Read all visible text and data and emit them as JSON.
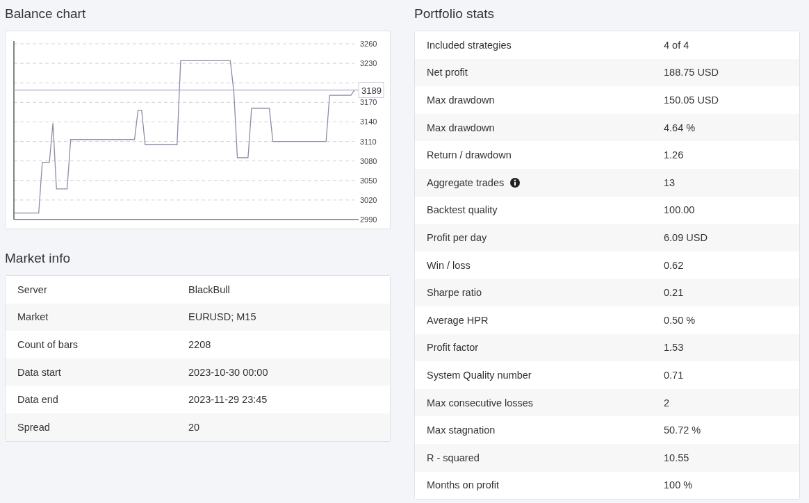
{
  "balance_chart": {
    "title": "Balance chart",
    "chart_data": {
      "type": "line",
      "grid": true,
      "series": [
        {
          "color": "#8c8ca8",
          "values": [
            3000,
            3000,
            3000,
            3000,
            3000,
            3000,
            3000,
            3000,
            3078,
            3078,
            3078,
            3138,
            3037,
            3037,
            3037,
            3037,
            3113,
            3113,
            3113,
            3113,
            3113,
            3113,
            3113,
            3113,
            3113,
            3113,
            3113,
            3113,
            3113,
            3113,
            3113,
            3113,
            3113,
            3113,
            3113,
            3158,
            3158,
            3105,
            3105,
            3105,
            3105,
            3105,
            3105,
            3105,
            3105,
            3105,
            3105,
            3234,
            3234,
            3234,
            3234,
            3234,
            3234,
            3234,
            3234,
            3234,
            3234,
            3234,
            3234,
            3234,
            3234,
            3234,
            3186,
            3085,
            3085,
            3085,
            3085,
            3161,
            3161,
            3161,
            3161,
            3161,
            3161,
            3110,
            3110,
            3110,
            3110,
            3110,
            3110,
            3110,
            3110,
            3110,
            3110,
            3110,
            3110,
            3110,
            3110,
            3110,
            3110,
            3181,
            3181,
            3181,
            3181,
            3181,
            3181,
            3181,
            3189
          ]
        }
      ],
      "ylim": [
        2990,
        3260
      ],
      "yticks": [
        2990,
        3020,
        3050,
        3080,
        3110,
        3140,
        3170,
        3230,
        3260
      ],
      "ref_lines": [
        {
          "value": 3189,
          "axis": "y",
          "label": "3189",
          "color": "#a7abd0"
        }
      ]
    }
  },
  "market_info": {
    "title": "Market info",
    "rows": [
      {
        "label": "Server",
        "value": "BlackBull"
      },
      {
        "label": "Market",
        "value": "EURUSD; M15"
      },
      {
        "label": "Count of bars",
        "value": "2208"
      },
      {
        "label": "Data start",
        "value": "2023-10-30 00:00"
      },
      {
        "label": "Data end",
        "value": "2023-11-29 23:45"
      },
      {
        "label": "Spread",
        "value": "20"
      }
    ]
  },
  "portfolio_stats": {
    "title": "Portfolio stats",
    "rows": [
      {
        "label": "Included strategies",
        "value": "4 of 4",
        "info_icon": false
      },
      {
        "label": "Net profit",
        "value": "188.75 USD",
        "info_icon": false
      },
      {
        "label": "Max drawdown",
        "value": "150.05 USD",
        "info_icon": false
      },
      {
        "label": "Max drawdown",
        "value": "4.64 %",
        "info_icon": false
      },
      {
        "label": "Return / drawdown",
        "value": "1.26",
        "info_icon": false
      },
      {
        "label": "Aggregate trades",
        "value": "13",
        "info_icon": true
      },
      {
        "label": "Backtest quality",
        "value": "100.00",
        "info_icon": false
      },
      {
        "label": "Profit per day",
        "value": "6.09 USD",
        "info_icon": false
      },
      {
        "label": "Win / loss",
        "value": "0.62",
        "info_icon": false
      },
      {
        "label": "Sharpe ratio",
        "value": "0.21",
        "info_icon": false
      },
      {
        "label": "Average HPR",
        "value": "0.50 %",
        "info_icon": false
      },
      {
        "label": "Profit factor",
        "value": "1.53",
        "info_icon": false
      },
      {
        "label": "System Quality number",
        "value": "0.71",
        "info_icon": false
      },
      {
        "label": "Max consecutive losses",
        "value": "2",
        "info_icon": false
      },
      {
        "label": "Max stagnation",
        "value": "50.72 %",
        "info_icon": false
      },
      {
        "label": "R - squared",
        "value": "10.55",
        "info_icon": false
      },
      {
        "label": "Months on profit",
        "value": "100 %",
        "info_icon": false
      }
    ]
  }
}
